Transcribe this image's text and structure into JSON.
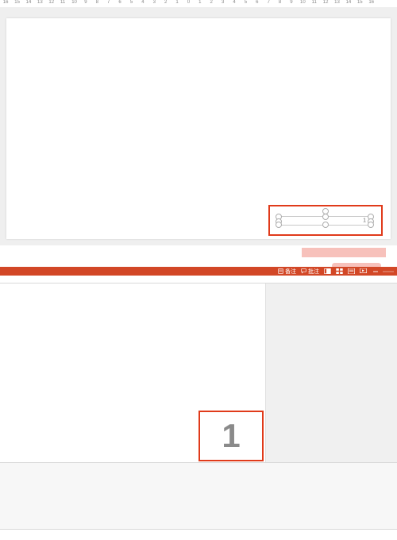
{
  "ruler": {
    "ticks": [
      "16",
      "15",
      "14",
      "13",
      "12",
      "11",
      "10",
      "9",
      "8",
      "7",
      "6",
      "5",
      "4",
      "3",
      "2",
      "1",
      "0",
      "1",
      "2",
      "3",
      "4",
      "5",
      "6",
      "7",
      "8",
      "9",
      "10",
      "11",
      "12",
      "13",
      "14",
      "15",
      "16"
    ]
  },
  "slide": {
    "page_number": "1"
  },
  "statusbar": {
    "notes_label": "备注",
    "comments_label": "批注"
  },
  "preview": {
    "page_number": "1"
  },
  "colors": {
    "accent": "#d24726",
    "highlight_border": "#e03a1a",
    "pink_strip": "#f7c1bb"
  }
}
